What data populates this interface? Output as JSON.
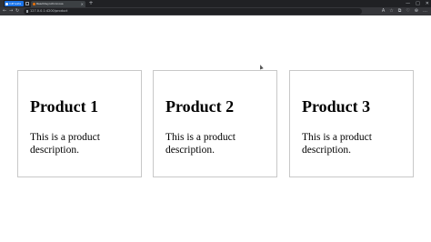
{
  "browser": {
    "inprivate_label": "InPrivate",
    "tab_title": "ReactAsynchronous",
    "new_tab_label": "+",
    "close_tab_label": "×",
    "url": "127.0.0.1:4200/product",
    "nav": {
      "back": "←",
      "forward": "→",
      "refresh": "↻"
    },
    "window_controls": {
      "minimize": "—",
      "maximize": "□",
      "close": "✕"
    },
    "toolbar_icons": [
      "A",
      "☆",
      "⧉",
      "♡",
      "⊕",
      "…"
    ]
  },
  "products": [
    {
      "title": "Product 1",
      "description": "This is a product description."
    },
    {
      "title": "Product 2",
      "description": "This is a product description."
    },
    {
      "title": "Product 3",
      "description": "This is a product description."
    }
  ]
}
